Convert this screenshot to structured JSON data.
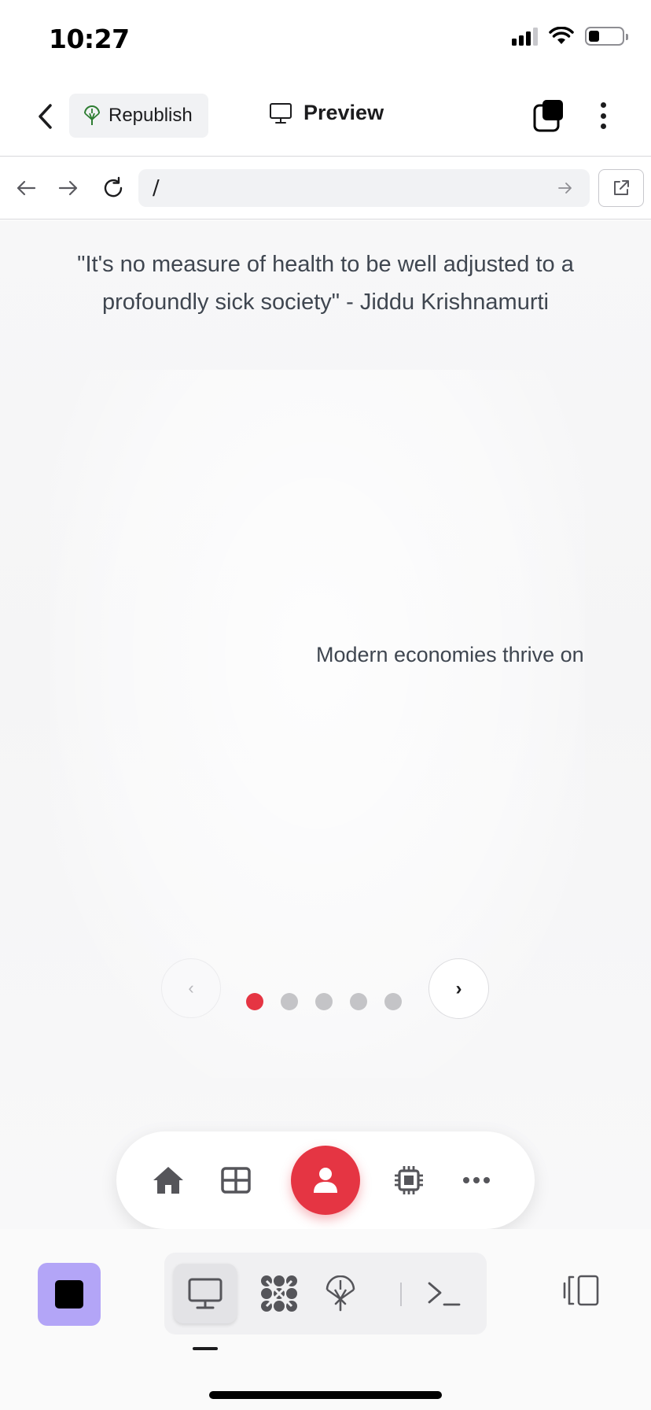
{
  "status_bar": {
    "time": "10:27"
  },
  "header": {
    "republish_label": "Republish",
    "title": "Preview"
  },
  "url_bar": {
    "value": "/"
  },
  "page": {
    "quote": "\"It's no measure of health to be well adjusted to a profoundly sick society\" - Jiddu Krishnamurti",
    "slide_text": "Modern economies thrive on",
    "carousel": {
      "prev_symbol": "‹",
      "next_symbol": "›",
      "total_slides": 5,
      "active_index": 0
    },
    "bottom_nav": {
      "items": [
        "home-icon",
        "grid-icon",
        "user-icon",
        "chip-icon",
        "more-icon"
      ],
      "active": "user-icon"
    }
  },
  "toolbar": {
    "tools": [
      "monitor-icon",
      "network-icon",
      "deploy-icon",
      "terminal-icon"
    ],
    "selected": "monitor-icon"
  },
  "colors": {
    "accent_red": "#e53543",
    "stop_purple": "#b3a5f7",
    "republish_green": "#2e7d32"
  }
}
